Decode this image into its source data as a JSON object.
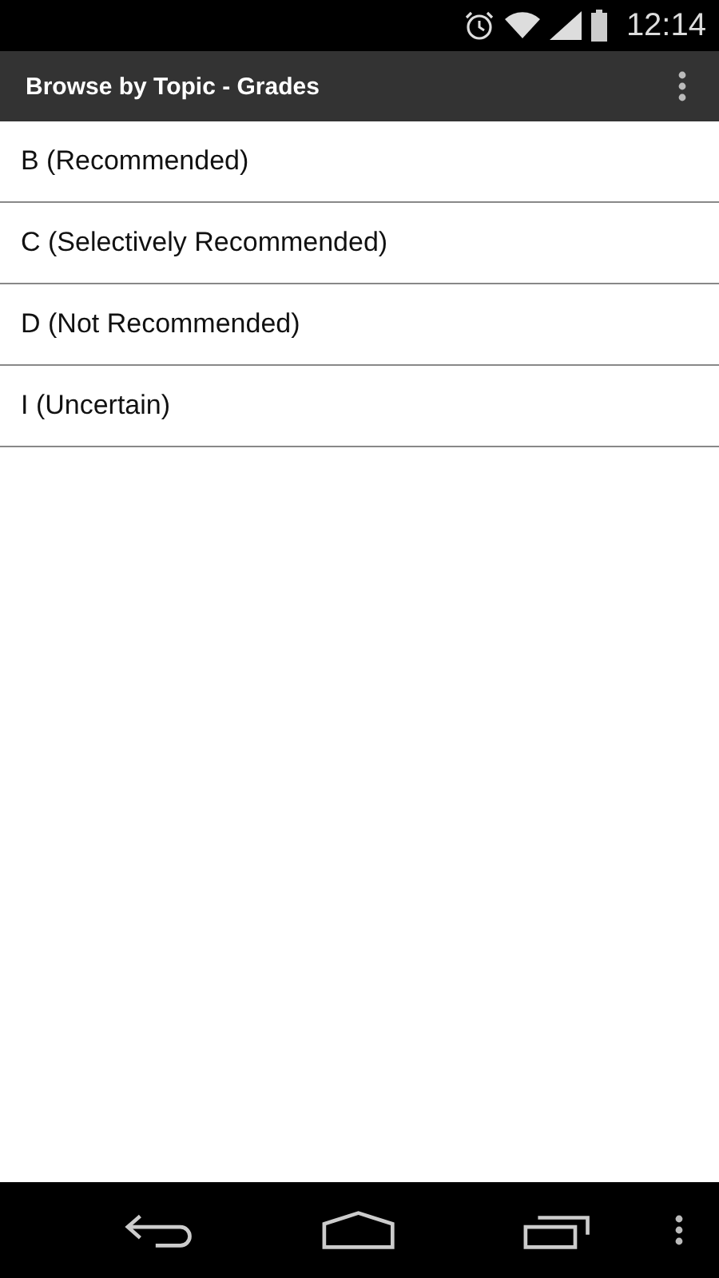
{
  "status_bar": {
    "time": "12:14"
  },
  "action_bar": {
    "title": "Browse by Topic - Grades"
  },
  "list": [
    {
      "label": "B (Recommended)"
    },
    {
      "label": "C (Selectively Recommended)"
    },
    {
      "label": "D (Not Recommended)"
    },
    {
      "label": "I (Uncertain)"
    }
  ]
}
